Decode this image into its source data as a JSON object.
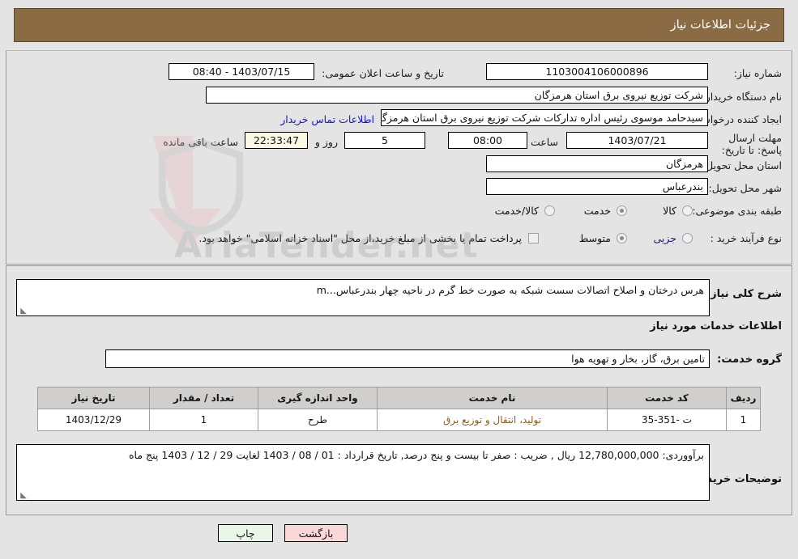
{
  "header": {
    "title": "جزئیات اطلاعات نیاز"
  },
  "form": {
    "need_number_label": "شماره نیاز:",
    "need_number_value": "1103004106000896",
    "announce_label": "تاریخ و ساعت اعلان عمومی:",
    "announce_value": "1403/07/15 - 08:40",
    "buyer_org_label": "نام دستگاه خریدار:",
    "buyer_org_value": "شرکت توزیع نیروی برق استان هرمزگان",
    "creator_label": "ایجاد کننده درخواست:",
    "creator_value": "سیدحامد موسوی رئیس اداره تدارکات شرکت توزیع نیروی برق استان هرمزگان",
    "contact_link": "اطلاعات تماس خریدار",
    "deadline_label": "مهلت ارسال پاسخ: تا تاریخ:",
    "deadline_date": "1403/07/21",
    "deadline_hour_label": "ساعت",
    "deadline_hour_value": "08:00",
    "remaining_days": "5",
    "remaining_days_label": "روز و",
    "remaining_time": "22:33:47",
    "remaining_suffix": "ساعت باقی مانده",
    "province_label": "استان محل تحویل:",
    "province_value": "هرمزگان",
    "city_label": "شهر محل تحویل:",
    "city_value": "بندرعباس",
    "category_label": "طبقه بندی موضوعی:",
    "category_options": [
      {
        "label": "کالا",
        "selected": false
      },
      {
        "label": "خدمت",
        "selected": true
      },
      {
        "label": "کالا/خدمت",
        "selected": false
      }
    ],
    "process_label": "نوع فرآیند خرید :",
    "process_options": [
      {
        "label": "جزیی",
        "selected": false
      },
      {
        "label": "متوسط",
        "selected": true
      }
    ],
    "treasury_checkbox_label": "پرداخت تمام یا بخشی از مبلغ خرید،از محل \"اسناد خزانه اسلامی\" خواهد بود.",
    "treasury_checked": false
  },
  "need": {
    "summary_label": "شرح کلی نیاز:",
    "summary_value": "هرس درختان و اصلاح اتصالات سست شبکه به صورت خط گرم در ناحیه چهار بندرعباس...m",
    "services_section_title": "اطلاعات خدمات مورد نیاز",
    "service_group_label": "گروه خدمت:",
    "service_group_value": "تامین برق، گاز، بخار و تهویه هوا"
  },
  "table": {
    "columns": [
      "ردیف",
      "کد خدمت",
      "نام خدمت",
      "واحد اندازه گیری",
      "تعداد / مقدار",
      "تاریخ نیاز"
    ],
    "rows": [
      {
        "row": "1",
        "code": "ت -351-35",
        "name": "تولید، انتقال و توزیع برق",
        "unit": "طرح",
        "qty": "1",
        "date": "1403/12/29"
      }
    ]
  },
  "buyer_notes": {
    "label": "توضیحات خریدار:",
    "value": "برآووردی: 12,780,000,000 ریال , ضریب : صفر تا بیست و پنج درصد, تاریخ قرارداد : 01 / 08 / 1403 لغایت 29 / 12 / 1403 پنج ماه"
  },
  "footer": {
    "print_label": "چاپ",
    "back_label": "بازگشت"
  },
  "watermark": {
    "text": "AriaTender.net"
  },
  "colors": {
    "header_bg": "#8b6b43",
    "link": "#1414d2",
    "service_name": "#8a5c1d",
    "table_header_bg": "#d0cfcd",
    "print_btn": "#e9f7e7",
    "back_btn": "#fbd8d8",
    "countdown_bg": "#fbf8e3"
  }
}
